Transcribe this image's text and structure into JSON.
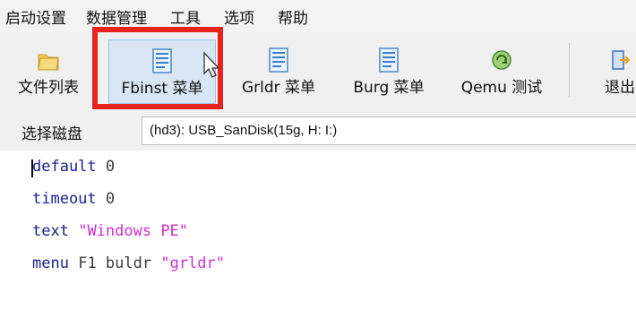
{
  "menubar": {
    "items": [
      "启动设置",
      "数据管理",
      "工具",
      "选项",
      "帮助"
    ]
  },
  "toolbar": {
    "buttons": [
      {
        "label": "文件列表",
        "icon": "folder-icon"
      },
      {
        "label": "Fbinst 菜单",
        "icon": "document-icon"
      },
      {
        "label": "Grldr 菜单",
        "icon": "document-icon"
      },
      {
        "label": "Burg 菜单",
        "icon": "document-icon"
      },
      {
        "label": "Qemu 测试",
        "icon": "qemu-icon"
      },
      {
        "label": "退出",
        "icon": "exit-icon"
      }
    ]
  },
  "disk": {
    "label": "选择磁盘",
    "value": "(hd3): USB_SanDisk(15g, H: I:)"
  },
  "editor": {
    "lines": [
      {
        "keyword": "default",
        "value": "0"
      },
      {
        "keyword": "timeout",
        "value": "0"
      },
      {
        "keyword": "text",
        "value": "\"Windows PE\""
      },
      {
        "keyword": "menu",
        "value": "F1 buldr",
        "string": "\"grldr\""
      }
    ]
  },
  "colors": {
    "highlight": "#e8221c",
    "keyword": "#1b1f8f",
    "string": "#d02fd0",
    "selected_button": "#d8e6f6"
  }
}
